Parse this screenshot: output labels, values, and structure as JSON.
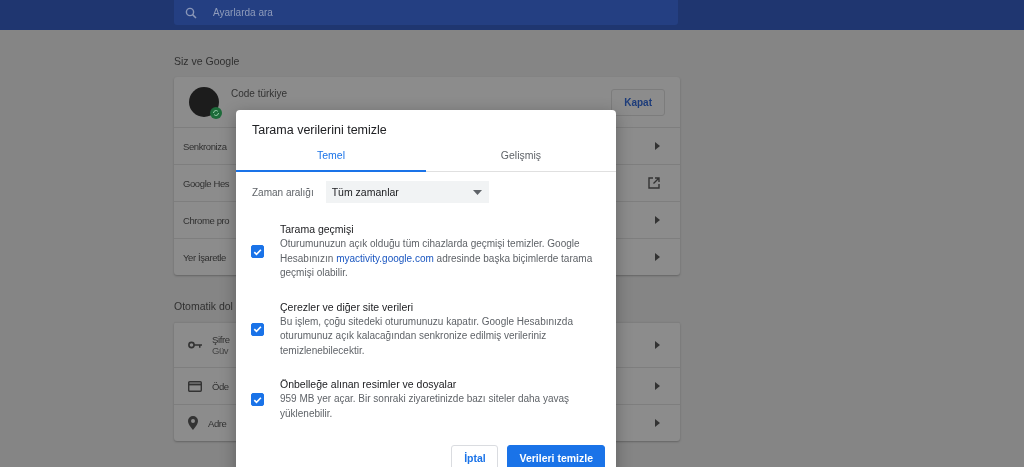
{
  "header": {
    "search": {
      "placeholder": "Ayarlarda ara"
    }
  },
  "sections": [
    {
      "title": "Siz ve Google",
      "profile": {
        "name": "Code türkiye",
        "button": "Kapat"
      },
      "rows": [
        {
          "label": "Senkroniza",
          "kind": "arrow"
        },
        {
          "label": "Google Hes",
          "kind": "external"
        },
        {
          "label": "Chrome pro",
          "kind": "arrow"
        },
        {
          "label": "Yer İşaretle",
          "kind": "arrow"
        }
      ]
    },
    {
      "title": "Otomatik dol",
      "rows": [
        {
          "label": "Şifre",
          "sublabel": "Güv",
          "kind": "arrow"
        },
        {
          "label": "Öde",
          "kind": "arrow"
        },
        {
          "label": "Adre",
          "kind": "arrow"
        }
      ]
    }
  ],
  "dialog": {
    "title": "Tarama verilerini temizle",
    "tabs": [
      {
        "label": "Temel",
        "selected": true
      },
      {
        "label": "Gelişmiş",
        "selected": false
      }
    ],
    "time_range": {
      "label": "Zaman aralığı",
      "value": "Tüm zamanlar"
    },
    "items": [
      {
        "title": "Tarama geçmişi",
        "checked": true,
        "description": "Oturumunuzun açık olduğu tüm cihazlarda geçmişi temizler. Google Hesabınızın ",
        "link": "myactivity.google.com",
        "description_after": " adresinde başka biçimlerde tarama geçmişi olabilir."
      },
      {
        "title": "Çerezler ve diğer site verileri",
        "checked": true,
        "description": "Bu işlem, çoğu sitedeki oturumunuzu kapatır. Google Hesabınızda oturumunuz açık kalacağından senkronize edilmiş verileriniz temizlenebilecektir."
      },
      {
        "title": "Önbelleğe alınan resimler ve dosyalar",
        "checked": true,
        "description": "959 MB yer açar. Bir sonraki ziyaretinizde bazı siteler daha yavaş yüklenebilir."
      }
    ],
    "buttons": [
      {
        "label": "İptal",
        "kind": "secondary"
      },
      {
        "label": "Verileri temizle",
        "kind": "primary"
      }
    ]
  }
}
